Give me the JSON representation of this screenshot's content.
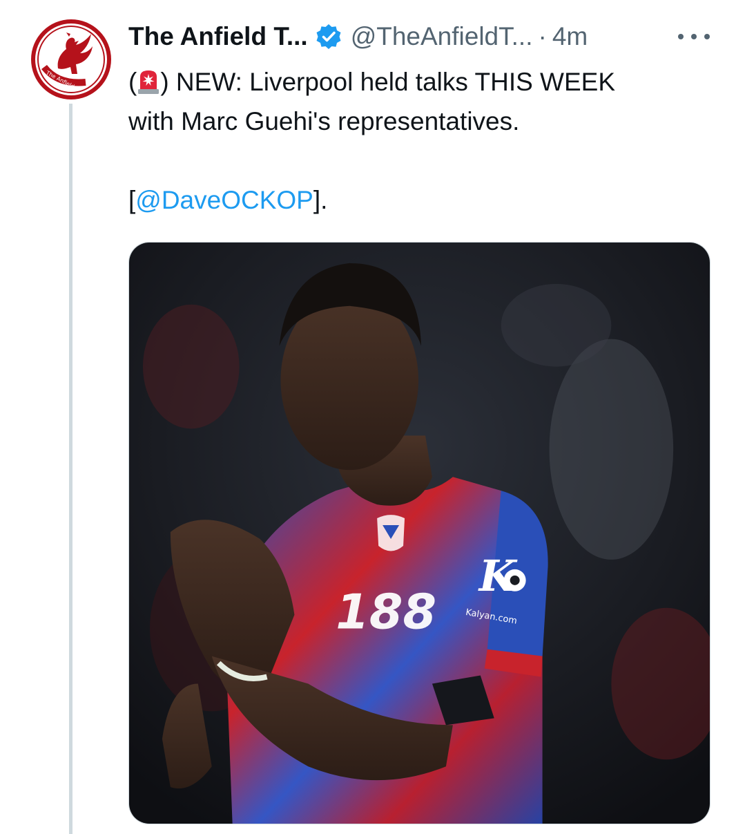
{
  "tweet": {
    "display_name": "The Anfield T...",
    "handle": "@TheAnfieldT...",
    "separator": "·",
    "time": "4m",
    "text_open": "(",
    "text_line1": ") NEW: Liverpool held talks THIS WEEK",
    "text_line2": "with Marc Guehi's representatives.",
    "bracket_open": "[",
    "mention": "@DaveOCKOP",
    "bracket_close": "].",
    "siren_icon": "police-car-light-emoji"
  },
  "avatar": {
    "logo_text": "The Anfield Talk",
    "brand_color": "#b5121b"
  },
  "media": {
    "shirt_number": "188",
    "sponsor": "Kalyan.com",
    "colors": {
      "shirt_red": "#c8232c",
      "shirt_blue": "#2a4fb8"
    }
  },
  "colors": {
    "text": "#0f1419",
    "secondary": "#536471",
    "link": "#1d9bf0",
    "verified": "#1d9bf0",
    "thread_line": "#cfd9de"
  }
}
